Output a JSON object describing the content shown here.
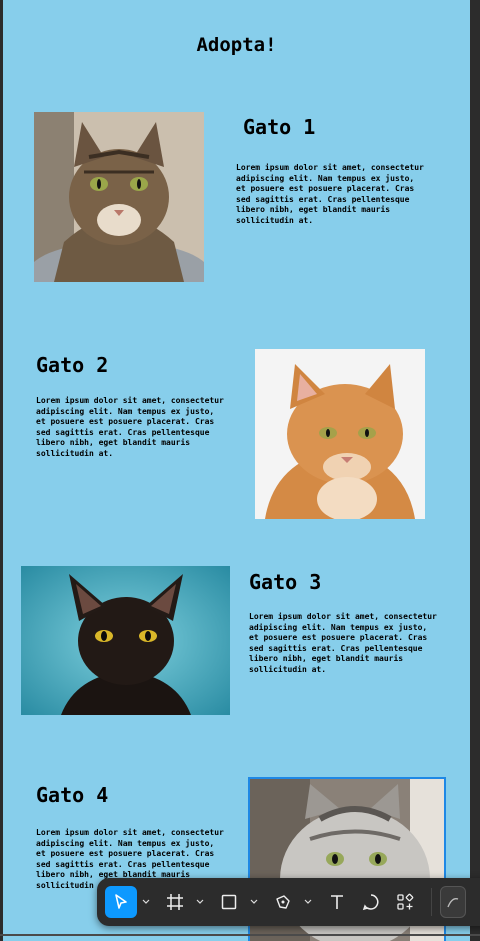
{
  "page": {
    "title": "Adopta!"
  },
  "cards": [
    {
      "title": "Gato 1",
      "text": "Lorem ipsum dolor sit amet, consectetur adipiscing elit. Nam tempus ex justo, et posuere est posuere placerat. Cras sed sagittis erat. Cras pellentesque libero nibh, eget blandit mauris sollicitudin at."
    },
    {
      "title": "Gato 2",
      "text": "Lorem ipsum dolor sit amet, consectetur adipiscing elit. Nam tempus ex justo, et posuere est posuere placerat. Cras sed sagittis erat. Cras pellentesque libero nibh, eget blandit mauris sollicitudin at."
    },
    {
      "title": "Gato 3",
      "text": "Lorem ipsum dolor sit amet, consectetur adipiscing elit. Nam tempus ex justo, et posuere est posuere placerat. Cras sed sagittis erat. Cras pellentesque libero nibh, eget blandit mauris sollicitudin at."
    },
    {
      "title": "Gato 4",
      "text": "Lorem ipsum dolor sit amet, consectetur adipiscing elit. Nam tempus ex justo, et posuere est posuere placerat. Cras sed sagittis erat. Cras pellentesque libero nibh, eget blandit mauris sollicitudin at."
    }
  ],
  "toolbar": {
    "tools": [
      "move-icon",
      "frame-icon",
      "rectangle-icon",
      "pen-icon",
      "text-icon",
      "comment-icon",
      "actions-icon"
    ],
    "active_tool": "move-icon"
  },
  "colors": {
    "canvas": "#87ceeb",
    "toolbar": "#2c2c2c",
    "accent": "#0d99ff",
    "selection": "#1e88e5"
  }
}
